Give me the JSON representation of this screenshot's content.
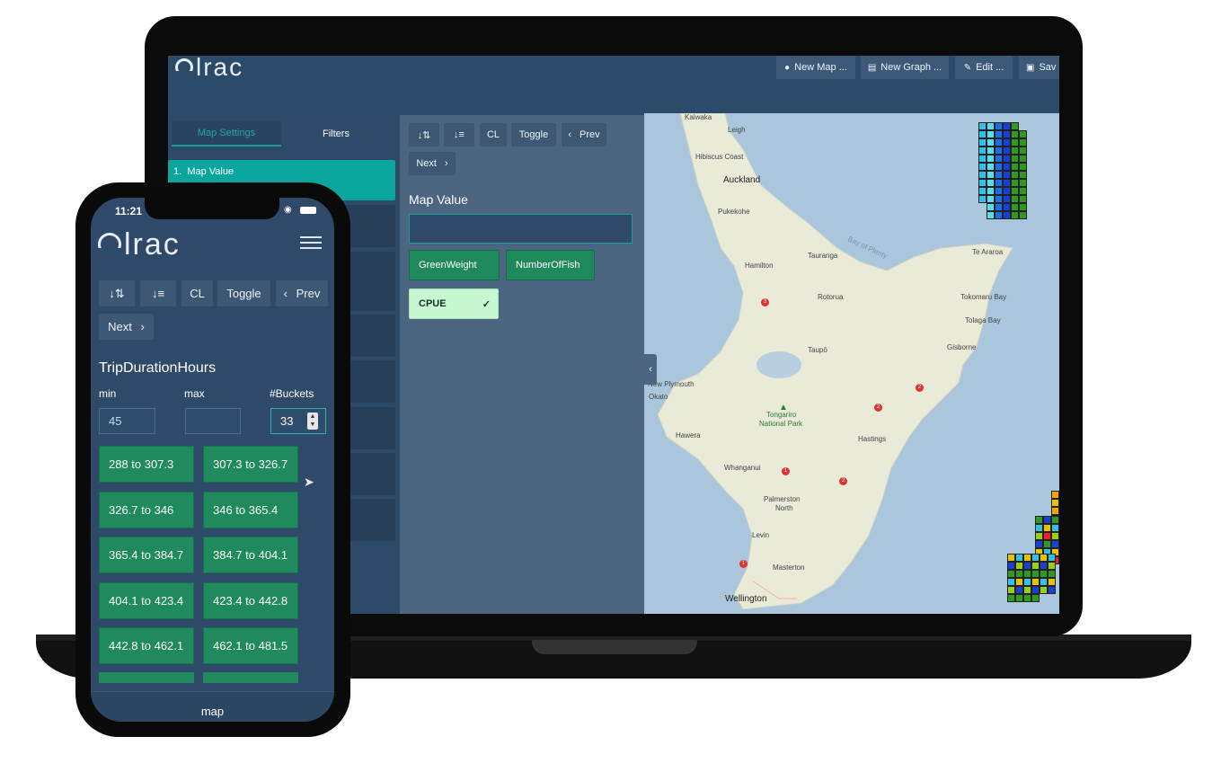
{
  "app": {
    "logo_text": "lrac"
  },
  "desktop": {
    "toolbar": {
      "new_map": "New Map ...",
      "new_graph": "New Graph ...",
      "edit": "Edit ...",
      "save": "Sav"
    },
    "tabs": {
      "map_settings": "Map Settings",
      "filters": "Filters"
    },
    "side_list": [
      {
        "number": "1.",
        "label": "Map Value"
      }
    ],
    "panel": {
      "sort_asc_icon": "sort-asc-icon",
      "sort_desc_icon": "sort-desc-icon",
      "cl": "CL",
      "toggle": "Toggle",
      "prev": "Prev",
      "next": "Next",
      "heading": "Map Value",
      "input_value": "",
      "options": [
        "GreenWeight",
        "NumberOfFish"
      ],
      "selected_option": "CPUE"
    },
    "map_labels": {
      "kaiwaka": "Kaiwaka",
      "leigh": "Leigh",
      "hibiscus_coast": "Hibiscus Coast",
      "auckland": "Auckland",
      "pukekohe": "Pukekohe",
      "hamilton": "Hamilton",
      "tauranga": "Tauranga",
      "bay_of_plenty": "Bay of Plenty",
      "te_araroa": "Te Araroa",
      "rotorua": "Rotorua",
      "tokomaru_bay": "Tokomaru Bay",
      "tolaga_bay": "Tolaga Bay",
      "taupo": "Taupō",
      "gisborne": "Gisborne",
      "new_plymouth": "New Plymouth",
      "okato": "Okato",
      "tongariro": "Tongariro",
      "national_park": "National Park",
      "hawera": "Hawera",
      "hastings": "Hastings",
      "whanganui": "Whanganui",
      "palmerston": "Palmerston",
      "north": "North",
      "levin": "Levin",
      "masterton": "Masterton",
      "wellington": "Wellington",
      "route_3": "3",
      "route_2a": "2",
      "route_2b": "2",
      "route_2c": "2",
      "route_1a": "1",
      "route_1b": "1"
    }
  },
  "mobile": {
    "status": {
      "time": "11:21"
    },
    "buttons": {
      "cl": "CL",
      "toggle": "Toggle",
      "prev": "Prev",
      "next": "Next"
    },
    "heading": "TripDurationHours",
    "labels": {
      "min": "min",
      "max": "max",
      "buckets": "#Buckets"
    },
    "fields": {
      "min": "45",
      "max": "",
      "buckets": "33"
    },
    "buckets": [
      "288 to 307.3",
      "307.3 to 326.7",
      "326.7 to 346",
      "346 to 365.4",
      "365.4 to 384.7",
      "384.7 to 404.1",
      "404.1 to 423.4",
      "423.4 to 442.8",
      "442.8 to 462.1",
      "462.1 to 481.5"
    ],
    "bottom_tab": "map"
  },
  "colors": {
    "teal": "#0aa59c",
    "button_green": "#1f8a5d",
    "selected": "#c9f7d2",
    "background": "#2c4a69"
  }
}
